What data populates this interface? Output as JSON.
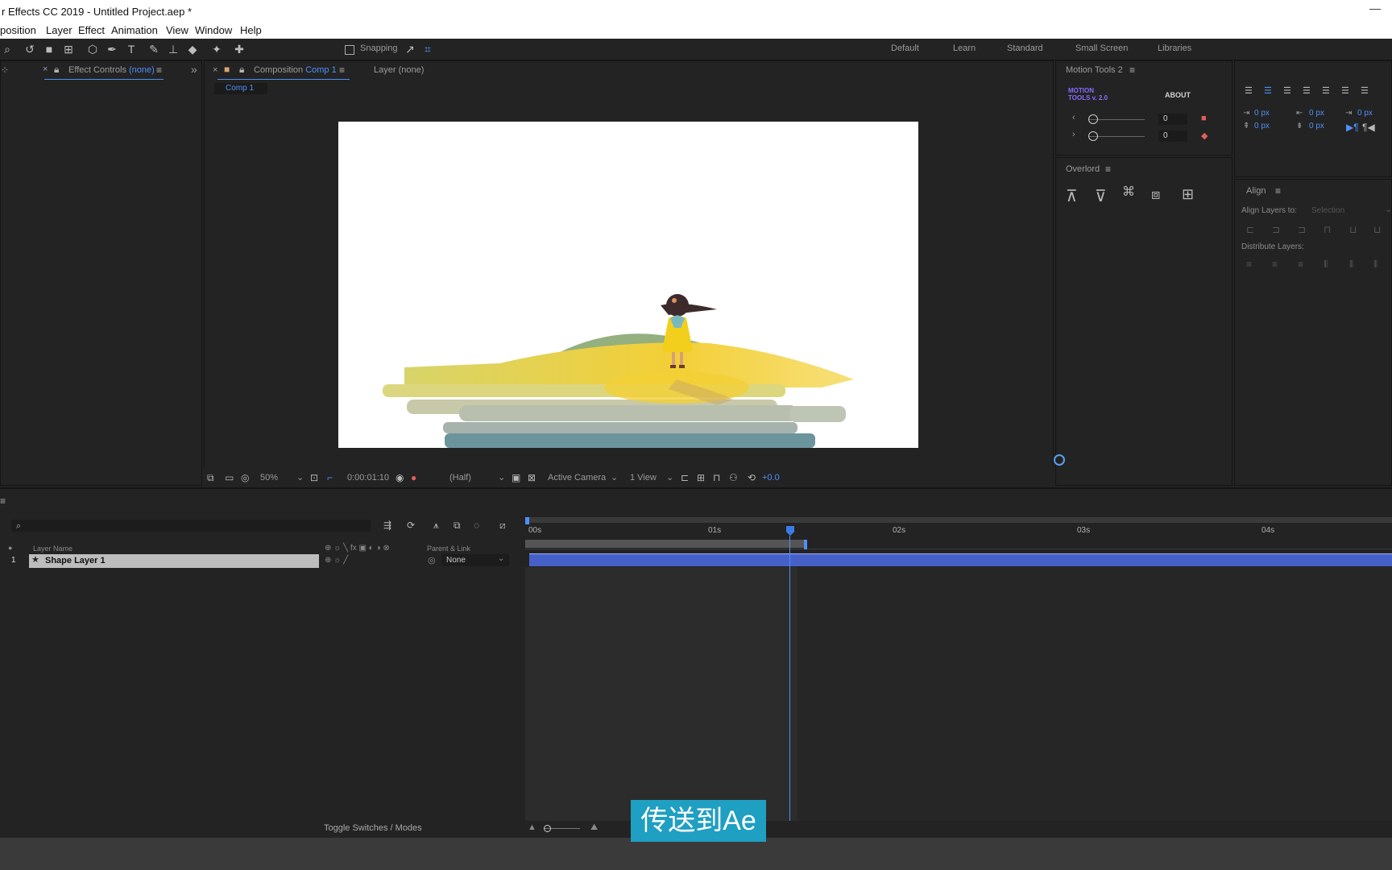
{
  "window": {
    "title": "r Effects CC 2019 - Untitled Project.aep *",
    "minimize": "—"
  },
  "menu": [
    "position",
    "Layer",
    "Effect",
    "Animation",
    "View",
    "Window",
    "Help"
  ],
  "toolbar": {
    "snapping": "Snapping",
    "workspaces": [
      "Default",
      "Learn",
      "Standard",
      "Small Screen",
      "Libraries"
    ]
  },
  "effect_controls": {
    "label": "Effect Controls",
    "value": "(none)",
    "expand": "»"
  },
  "composition": {
    "label": "Composition",
    "name": "Comp 1",
    "layer_label": "Layer",
    "layer_value": "(none)",
    "breadcrumb": "Comp 1"
  },
  "viewer_bar": {
    "zoom": "50%",
    "timecode": "0:00:01:10",
    "resolution": "(Half)",
    "camera": "Active Camera",
    "views": "1 View",
    "exposure": "+0.0"
  },
  "motion_tools": {
    "title": "Motion Tools 2",
    "logo_line1": "MOTION",
    "logo_line2": "TOOLS v. 2.0",
    "about": "ABOUT",
    "value1": "0",
    "value2": "0"
  },
  "align_px": {
    "v1": "0 px",
    "v2": "0 px",
    "v3": "0 px",
    "v4": "0 px",
    "v5": "0 px"
  },
  "overlord": {
    "title": "Overlord"
  },
  "align": {
    "title": "Align",
    "align_layers_to": "Align Layers to:",
    "selection": "Selection",
    "distribute": "Distribute Layers:"
  },
  "timeline": {
    "col_layer_name": "Layer Name",
    "col_parent": "Parent & Link",
    "layer_number": "1",
    "layer_name": "Shape Layer 1",
    "parent_value": "None",
    "toggle": "Toggle Switches / Modes",
    "ruler": [
      "00s",
      "01s",
      "02s",
      "03s",
      "04s"
    ]
  },
  "subtitle": "传送到Ae"
}
